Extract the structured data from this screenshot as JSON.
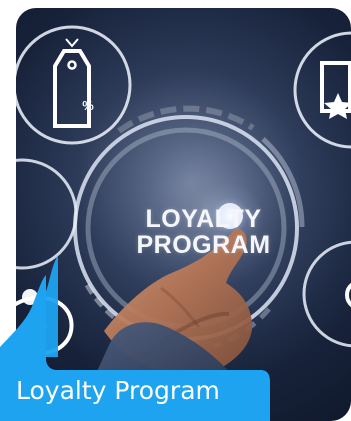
{
  "card": {
    "title": "Loyalty Program"
  },
  "hero": {
    "line1": "LOYALTY",
    "line2": "PROGRAM",
    "price_tag_symbol": "%"
  },
  "icons": {
    "top_left": "price-tag-icon",
    "top_right": "star-card-icon",
    "left_middle": "piggy-bank-icon",
    "right_middle": "coin-icon"
  },
  "colors": {
    "accent": "#1ea3f0",
    "badge_text": "#ffffff",
    "background_dark": "#17223a"
  }
}
